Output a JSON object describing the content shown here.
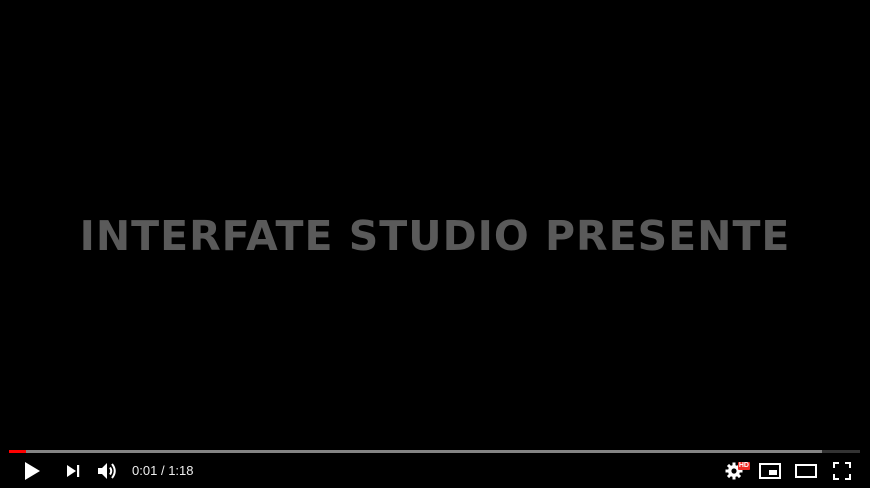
{
  "video": {
    "overlay_title": "INTERFATE STUDIO PRESENTE"
  },
  "player": {
    "progress_played_fraction": 0.02,
    "progress_loaded_fraction": 0.955,
    "accent_color": "#ff0000",
    "hd_badge": "HD",
    "time_separator": "/",
    "time_current": "0:01",
    "time_total": "1:18"
  },
  "controls": {
    "icons": [
      "play-icon",
      "next-icon",
      "volume-icon",
      "settings-icon",
      "miniplayer-icon",
      "theater-mode-icon",
      "fullscreen-icon"
    ]
  }
}
